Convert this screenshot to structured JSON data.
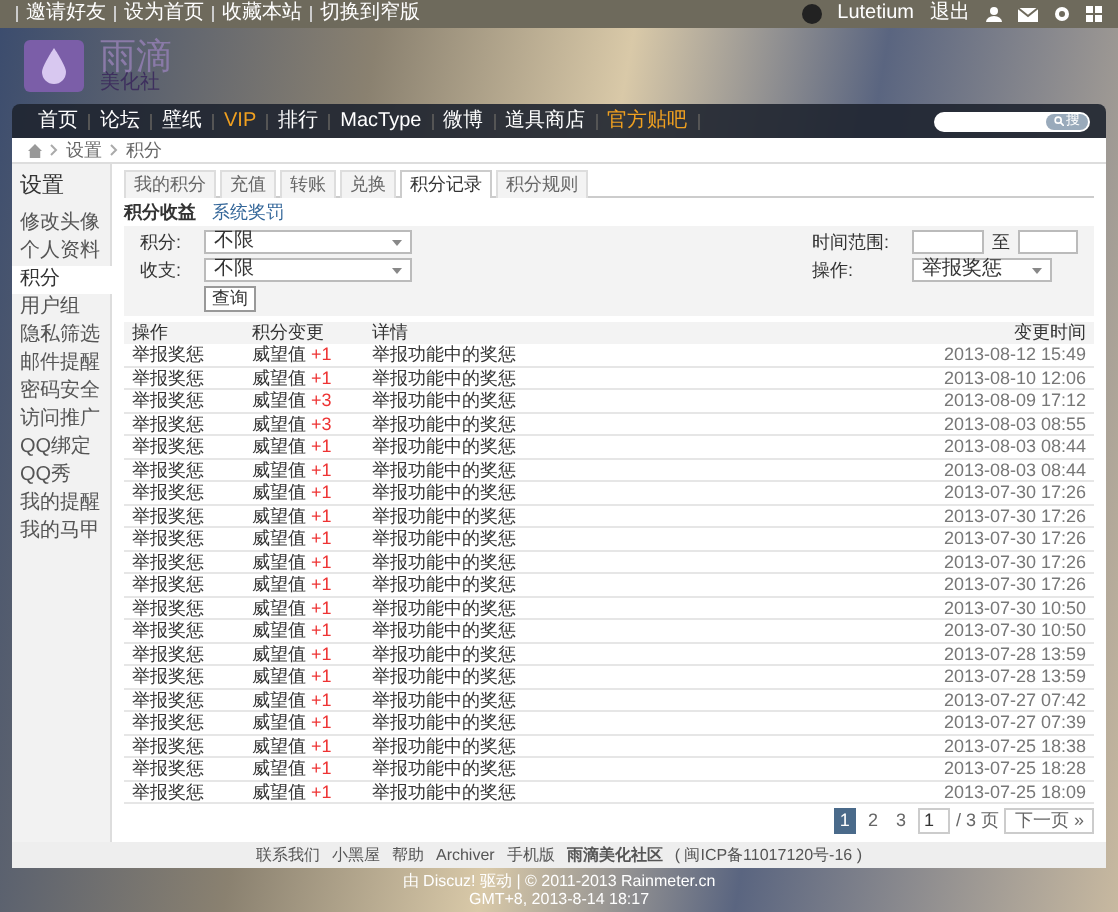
{
  "top_bar": {
    "links": [
      "邀请好友",
      "设为首页",
      "收藏本站",
      "切换到窄版"
    ],
    "user": "Lutetium",
    "logout": "退出"
  },
  "logo": {
    "name": "雨滴",
    "tagline": "美化社"
  },
  "nav": [
    {
      "label": "首页",
      "highlighted": false
    },
    {
      "label": "论坛",
      "highlighted": false
    },
    {
      "label": "壁纸",
      "highlighted": false
    },
    {
      "label": "VIP",
      "highlighted": true
    },
    {
      "label": "排行",
      "highlighted": false
    },
    {
      "label": "MacType",
      "highlighted": false
    },
    {
      "label": "微博",
      "highlighted": false
    },
    {
      "label": "道具商店",
      "highlighted": false
    },
    {
      "label": "官方贴吧",
      "highlighted": true
    }
  ],
  "search": {
    "button": "搜"
  },
  "breadcrumb": [
    "设置",
    "积分"
  ],
  "sidebar": {
    "title": "设置",
    "items": [
      {
        "label": "修改头像",
        "selected": false
      },
      {
        "label": "个人资料",
        "selected": false
      },
      {
        "label": "积分",
        "selected": true
      },
      {
        "label": "用户组",
        "selected": false
      },
      {
        "label": "隐私筛选",
        "selected": false
      },
      {
        "label": "邮件提醒",
        "selected": false
      },
      {
        "label": "密码安全",
        "selected": false
      },
      {
        "label": "访问推广",
        "selected": false
      },
      {
        "label": "QQ绑定",
        "selected": false
      },
      {
        "label": "QQ秀",
        "selected": false
      },
      {
        "label": "我的提醒",
        "selected": false
      },
      {
        "label": "我的马甲",
        "selected": false
      }
    ]
  },
  "tabs": [
    {
      "label": "我的积分",
      "selected": false
    },
    {
      "label": "充值",
      "selected": false
    },
    {
      "label": "转账",
      "selected": false
    },
    {
      "label": "兑换",
      "selected": false
    },
    {
      "label": "积分记录",
      "selected": true
    },
    {
      "label": "积分规则",
      "selected": false
    }
  ],
  "subtabs": [
    {
      "label": "积分收益",
      "selected": true
    },
    {
      "label": "系统奖罚",
      "selected": false
    }
  ],
  "filters": {
    "credit": {
      "label": "积分:",
      "value": "不限"
    },
    "time_range": {
      "label": "时间范围:",
      "separator": "至"
    },
    "direction": {
      "label": "收支:",
      "value": "不限"
    },
    "operation": {
      "label": "操作:",
      "value": "举报奖惩"
    },
    "button": "查询"
  },
  "table": {
    "columns": [
      "操作",
      "积分变更",
      "详情",
      "变更时间"
    ],
    "rows": [
      {
        "operation": "举报奖惩",
        "credit": "威望值",
        "change": "+1",
        "detail": "举报功能中的奖惩",
        "time": "2013-08-12 15:49"
      },
      {
        "operation": "举报奖惩",
        "credit": "威望值",
        "change": "+1",
        "detail": "举报功能中的奖惩",
        "time": "2013-08-10 12:06"
      },
      {
        "operation": "举报奖惩",
        "credit": "威望值",
        "change": "+3",
        "detail": "举报功能中的奖惩",
        "time": "2013-08-09 17:12"
      },
      {
        "operation": "举报奖惩",
        "credit": "威望值",
        "change": "+3",
        "detail": "举报功能中的奖惩",
        "time": "2013-08-03 08:55"
      },
      {
        "operation": "举报奖惩",
        "credit": "威望值",
        "change": "+1",
        "detail": "举报功能中的奖惩",
        "time": "2013-08-03 08:44"
      },
      {
        "operation": "举报奖惩",
        "credit": "威望值",
        "change": "+1",
        "detail": "举报功能中的奖惩",
        "time": "2013-08-03 08:44"
      },
      {
        "operation": "举报奖惩",
        "credit": "威望值",
        "change": "+1",
        "detail": "举报功能中的奖惩",
        "time": "2013-07-30 17:26"
      },
      {
        "operation": "举报奖惩",
        "credit": "威望值",
        "change": "+1",
        "detail": "举报功能中的奖惩",
        "time": "2013-07-30 17:26"
      },
      {
        "operation": "举报奖惩",
        "credit": "威望值",
        "change": "+1",
        "detail": "举报功能中的奖惩",
        "time": "2013-07-30 17:26"
      },
      {
        "operation": "举报奖惩",
        "credit": "威望值",
        "change": "+1",
        "detail": "举报功能中的奖惩",
        "time": "2013-07-30 17:26"
      },
      {
        "operation": "举报奖惩",
        "credit": "威望值",
        "change": "+1",
        "detail": "举报功能中的奖惩",
        "time": "2013-07-30 17:26"
      },
      {
        "operation": "举报奖惩",
        "credit": "威望值",
        "change": "+1",
        "detail": "举报功能中的奖惩",
        "time": "2013-07-30 10:50"
      },
      {
        "operation": "举报奖惩",
        "credit": "威望值",
        "change": "+1",
        "detail": "举报功能中的奖惩",
        "time": "2013-07-30 10:50"
      },
      {
        "operation": "举报奖惩",
        "credit": "威望值",
        "change": "+1",
        "detail": "举报功能中的奖惩",
        "time": "2013-07-28 13:59"
      },
      {
        "operation": "举报奖惩",
        "credit": "威望值",
        "change": "+1",
        "detail": "举报功能中的奖惩",
        "time": "2013-07-28 13:59"
      },
      {
        "operation": "举报奖惩",
        "credit": "威望值",
        "change": "+1",
        "detail": "举报功能中的奖惩",
        "time": "2013-07-27 07:42"
      },
      {
        "operation": "举报奖惩",
        "credit": "威望值",
        "change": "+1",
        "detail": "举报功能中的奖惩",
        "time": "2013-07-27 07:39"
      },
      {
        "operation": "举报奖惩",
        "credit": "威望值",
        "change": "+1",
        "detail": "举报功能中的奖惩",
        "time": "2013-07-25 18:38"
      },
      {
        "operation": "举报奖惩",
        "credit": "威望值",
        "change": "+1",
        "detail": "举报功能中的奖惩",
        "time": "2013-07-25 18:28"
      },
      {
        "operation": "举报奖惩",
        "credit": "威望值",
        "change": "+1",
        "detail": "举报功能中的奖惩",
        "time": "2013-07-25 18:09"
      }
    ]
  },
  "pagination": {
    "pages": [
      {
        "label": "1",
        "selected": true
      },
      {
        "label": "2",
        "selected": false
      },
      {
        "label": "3",
        "selected": false
      }
    ],
    "page_input": "1",
    "total": "/ 3 页",
    "next": "下一页 »"
  },
  "footer": {
    "links": [
      "联系我们",
      "小黑屋",
      "帮助",
      "Archiver",
      "手机版"
    ],
    "site": "雨滴美化社区",
    "icp": "( 闽ICP备11017120号-16 )",
    "powered": "由 Discuz! 驱动 | © 2011-2013 Rainmeter.cn",
    "time": "GMT+8, 2013-8-14 18:17"
  }
}
